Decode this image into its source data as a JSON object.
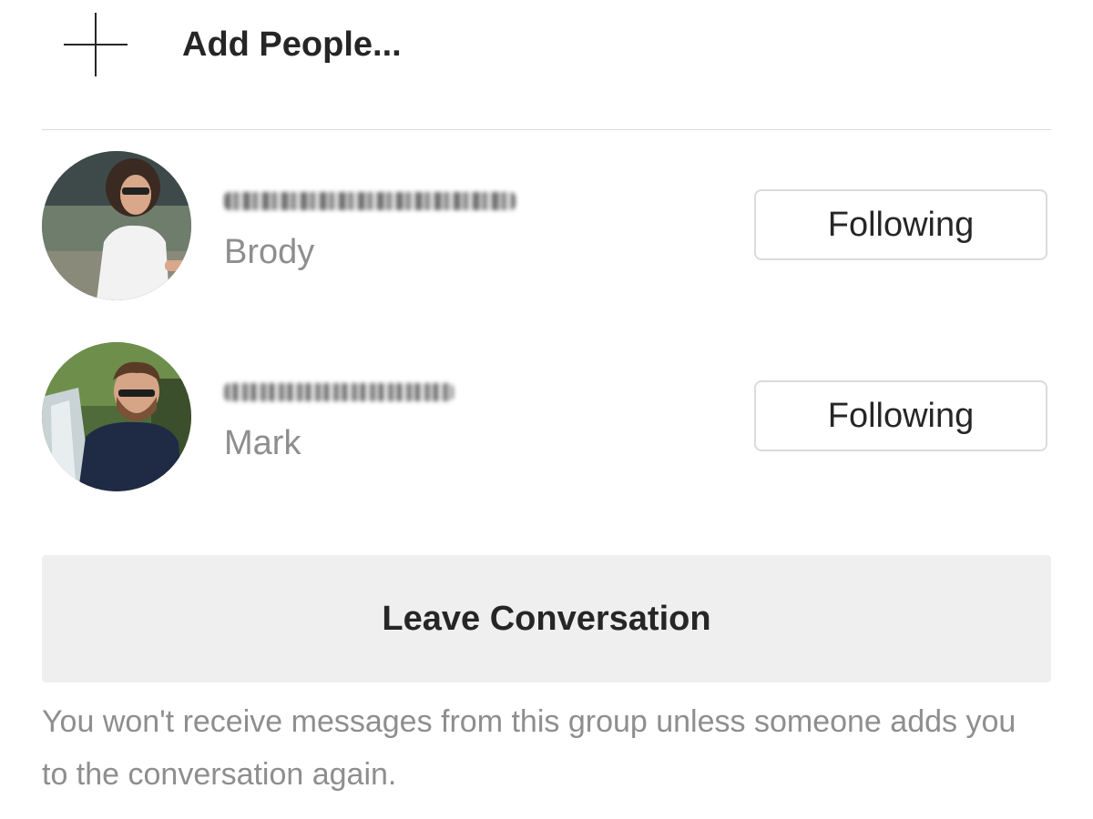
{
  "add_people": {
    "icon": "plus-icon",
    "label": "Add People..."
  },
  "members": [
    {
      "name": "Brody",
      "button_label": "Following",
      "username_obscured": true
    },
    {
      "name": "Mark",
      "button_label": "Following",
      "username_obscured": true
    }
  ],
  "leave": {
    "button_label": "Leave Conversation",
    "note": "You won't receive messages from this group unless someone adds you to the conversation again."
  },
  "colors": {
    "text_primary": "#262626",
    "text_secondary": "#8e8e8e",
    "divider": "#dbdbdb",
    "leave_button_bg": "#efefef"
  }
}
